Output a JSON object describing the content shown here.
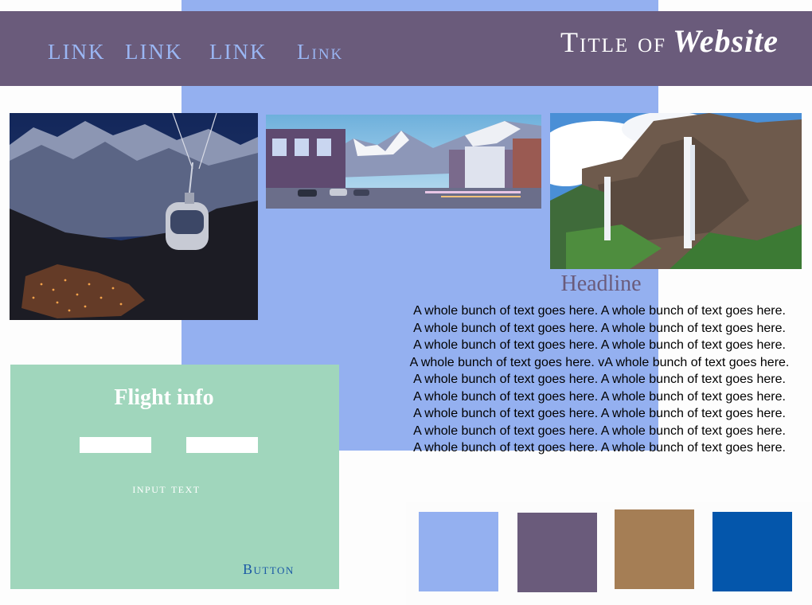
{
  "header": {
    "links": [
      "LINK",
      "LINK",
      "LINK",
      "Link"
    ],
    "title_part1": "Title of",
    "title_part2": "Website"
  },
  "photos": {
    "gondola": "gondola-night-photo",
    "town": "mountain-town-street-photo",
    "waterfall": "waterfall-cliff-photo"
  },
  "article": {
    "headline": "Headline",
    "body": "A whole bunch of text goes here. A whole bunch of text goes here. A whole bunch of text goes here. A whole bunch of text goes here. A whole bunch of text goes here. A whole bunch of text goes here. A whole bunch of text goes here. vA whole bunch of text goes here. A whole bunch of text goes here. A whole bunch of text goes here. A whole bunch of text goes here. A whole bunch of text goes here. A whole bunch of text goes here. A whole bunch of text goes here. A whole bunch of text goes here. A whole bunch of text goes here. A whole bunch of text goes here. A whole bunch of text goes here."
  },
  "flight": {
    "title": "Flight info",
    "input_label": "input text",
    "button_label": "Button"
  },
  "palette": {
    "colors": [
      "#94b0f0",
      "#6a5b7b",
      "#a57e55",
      "#0456ab"
    ]
  },
  "theme": {
    "background": "#fdfdfd",
    "header_bg": "#6a5b7b",
    "accent_blue": "#94b0f0",
    "panel_green": "#a0d6bc"
  }
}
